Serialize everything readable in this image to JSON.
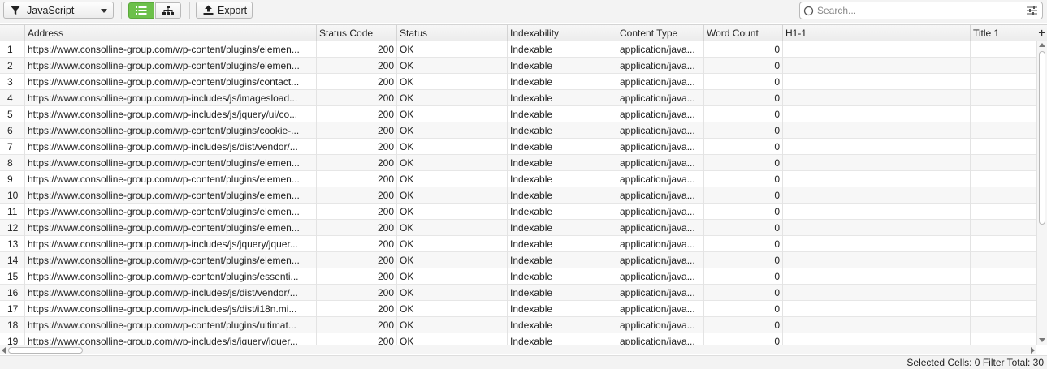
{
  "toolbar": {
    "filter_value": "JavaScript",
    "export_label": "Export",
    "search_placeholder": "Search..."
  },
  "table": {
    "row_number_header": "",
    "columns": [
      "Address",
      "Status Code",
      "Status",
      "Indexability",
      "Content Type",
      "Word Count",
      "H1-1",
      "Title 1"
    ],
    "add_column_label": "+",
    "rows": [
      {
        "n": "1",
        "address": "https://www.consolline-group.com/wp-content/plugins/elemen...",
        "code": "200",
        "status": "OK",
        "index": "Indexable",
        "type": "application/java...",
        "words": "0"
      },
      {
        "n": "2",
        "address": "https://www.consolline-group.com/wp-content/plugins/elemen...",
        "code": "200",
        "status": "OK",
        "index": "Indexable",
        "type": "application/java...",
        "words": "0"
      },
      {
        "n": "3",
        "address": "https://www.consolline-group.com/wp-content/plugins/contact...",
        "code": "200",
        "status": "OK",
        "index": "Indexable",
        "type": "application/java...",
        "words": "0"
      },
      {
        "n": "4",
        "address": "https://www.consolline-group.com/wp-includes/js/imagesload...",
        "code": "200",
        "status": "OK",
        "index": "Indexable",
        "type": "application/java...",
        "words": "0"
      },
      {
        "n": "5",
        "address": "https://www.consolline-group.com/wp-includes/js/jquery/ui/co...",
        "code": "200",
        "status": "OK",
        "index": "Indexable",
        "type": "application/java...",
        "words": "0"
      },
      {
        "n": "6",
        "address": "https://www.consolline-group.com/wp-content/plugins/cookie-...",
        "code": "200",
        "status": "OK",
        "index": "Indexable",
        "type": "application/java...",
        "words": "0"
      },
      {
        "n": "7",
        "address": "https://www.consolline-group.com/wp-includes/js/dist/vendor/...",
        "code": "200",
        "status": "OK",
        "index": "Indexable",
        "type": "application/java...",
        "words": "0"
      },
      {
        "n": "8",
        "address": "https://www.consolline-group.com/wp-content/plugins/elemen...",
        "code": "200",
        "status": "OK",
        "index": "Indexable",
        "type": "application/java...",
        "words": "0"
      },
      {
        "n": "9",
        "address": "https://www.consolline-group.com/wp-content/plugins/elemen...",
        "code": "200",
        "status": "OK",
        "index": "Indexable",
        "type": "application/java...",
        "words": "0"
      },
      {
        "n": "10",
        "address": "https://www.consolline-group.com/wp-content/plugins/elemen...",
        "code": "200",
        "status": "OK",
        "index": "Indexable",
        "type": "application/java...",
        "words": "0"
      },
      {
        "n": "11",
        "address": "https://www.consolline-group.com/wp-content/plugins/elemen...",
        "code": "200",
        "status": "OK",
        "index": "Indexable",
        "type": "application/java...",
        "words": "0"
      },
      {
        "n": "12",
        "address": "https://www.consolline-group.com/wp-content/plugins/elemen...",
        "code": "200",
        "status": "OK",
        "index": "Indexable",
        "type": "application/java...",
        "words": "0"
      },
      {
        "n": "13",
        "address": "https://www.consolline-group.com/wp-includes/js/jquery/jquer...",
        "code": "200",
        "status": "OK",
        "index": "Indexable",
        "type": "application/java...",
        "words": "0"
      },
      {
        "n": "14",
        "address": "https://www.consolline-group.com/wp-content/plugins/elemen...",
        "code": "200",
        "status": "OK",
        "index": "Indexable",
        "type": "application/java...",
        "words": "0"
      },
      {
        "n": "15",
        "address": "https://www.consolline-group.com/wp-content/plugins/essenti...",
        "code": "200",
        "status": "OK",
        "index": "Indexable",
        "type": "application/java...",
        "words": "0"
      },
      {
        "n": "16",
        "address": "https://www.consolline-group.com/wp-includes/js/dist/vendor/...",
        "code": "200",
        "status": "OK",
        "index": "Indexable",
        "type": "application/java...",
        "words": "0"
      },
      {
        "n": "17",
        "address": "https://www.consolline-group.com/wp-includes/js/dist/i18n.mi...",
        "code": "200",
        "status": "OK",
        "index": "Indexable",
        "type": "application/java...",
        "words": "0"
      },
      {
        "n": "18",
        "address": "https://www.consolline-group.com/wp-content/plugins/ultimat...",
        "code": "200",
        "status": "OK",
        "index": "Indexable",
        "type": "application/java...",
        "words": "0"
      },
      {
        "n": "19",
        "address": "https://www.consolline-group.com/wp-includes/js/jquery/jquer...",
        "code": "200",
        "status": "OK",
        "index": "Indexable",
        "type": "application/java...",
        "words": "0"
      }
    ]
  },
  "statusbar": {
    "selected_label": "Selected Cells:",
    "selected_value": "0",
    "filter_label": "Filter Total:",
    "filter_value": "30"
  },
  "icons": {
    "filter": "funnel-icon",
    "list_view": "list-view-icon",
    "tree_view": "tree-view-icon",
    "export": "upload-icon",
    "search": "search-icon",
    "search_options": "sliders-icon"
  },
  "colors": {
    "active_view": "#6cc04a",
    "toolbar_bg": "#f3f3f3",
    "alt_row": "#f7f7f7"
  }
}
